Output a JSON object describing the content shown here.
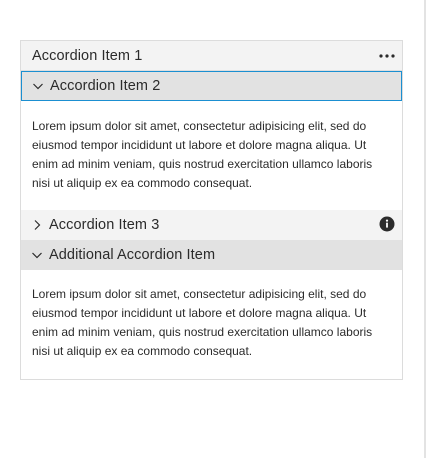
{
  "accordion": {
    "items": [
      {
        "label": "Accordion Item 1",
        "expanded": false,
        "action_icon": "more-horizontal-icon"
      },
      {
        "label": "Accordion Item 2",
        "expanded": true,
        "focused": true,
        "chevron_icon": "chevron-down-icon",
        "content": "Lorem ipsum dolor sit amet, consectetur adipisicing elit, sed do eiusmod tempor incididunt ut labore et dolore magna aliqua. Ut enim ad minim veniam, quis nostrud exercitation ullamco laboris nisi ut aliquip ex ea commodo consequat."
      },
      {
        "label": "Accordion Item 3",
        "expanded": false,
        "chevron_icon": "chevron-right-icon",
        "action_icon": "info-icon"
      },
      {
        "label": "Additional Accordion Item",
        "expanded": true,
        "chevron_icon": "chevron-down-icon",
        "content": "Lorem ipsum dolor sit amet, consectetur adipisicing elit, sed do eiusmod tempor incididunt ut labore et dolore magna aliqua. Ut enim ad minim veniam, quis nostrud exercitation ullamco laboris nisi ut aliquip ex ea commodo consequat."
      }
    ]
  },
  "colors": {
    "focus_border": "#1b8fd1",
    "header_light": "#f3f3f3",
    "header_dark": "#e2e2e2",
    "text": "#2b2b2b"
  }
}
